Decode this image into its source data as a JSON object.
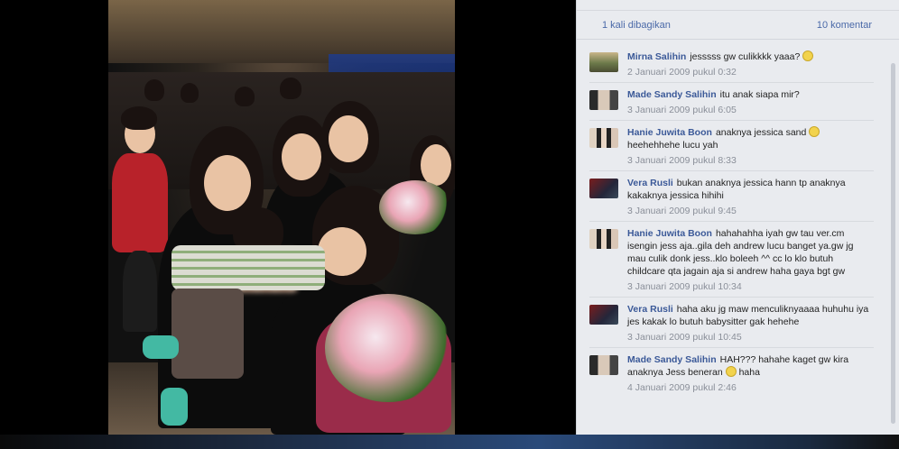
{
  "meta": {
    "shares": "1 kali dibagikan",
    "comments_count": "10 komentar"
  },
  "colors": {
    "panel_bg": "#e9ebef",
    "link": "#3b5998",
    "timestamp": "#8a8f99"
  },
  "comments": [
    {
      "author": "Mirna Salihin",
      "text": "jesssss gw culikkkk yaaa?",
      "emoticon": "smiley-icon",
      "time": "2 Januari 2009 pukul 0:32"
    },
    {
      "author": "Made Sandy Salihin",
      "text": "itu anak siapa mir?",
      "time": "3 Januari 2009 pukul 6:05"
    },
    {
      "author": "Hanie Juwita Boon",
      "text": "anaknya jessica sand",
      "text2": "heehehhehe lucu yah",
      "emoticon": "smiley-icon",
      "time": "3 Januari 2009 pukul 8:33"
    },
    {
      "author": "Vera Rusli",
      "text": "bukan anaknya jessica hann tp anaknya kakaknya jessica hihihi",
      "time": "3 Januari 2009 pukul 9:45"
    },
    {
      "author": "Hanie Juwita Boon",
      "text": "hahahahha iyah gw tau ver.cm isengin jess aja..gila deh andrew lucu banget ya.gw jg mau culik donk jess..klo boleeh ^^ cc lo klo butuh childcare qta jagain aja si andrew haha gaya bgt gw",
      "time": "3 Januari 2009 pukul 10:34"
    },
    {
      "author": "Vera Rusli",
      "text": "haha aku jg maw menculiknyaaaa huhuhu iya jes kakak lo butuh babysitter gak hehehe",
      "time": "3 Januari 2009 pukul 10:45"
    },
    {
      "author": "Made Sandy Salihin",
      "text": "HAH??? hahahe kaget gw kira anaknya Jess beneran",
      "text2": "haha",
      "emoticon": "smiley-icon",
      "time": "4 Januari 2009 pukul 2:46"
    }
  ]
}
